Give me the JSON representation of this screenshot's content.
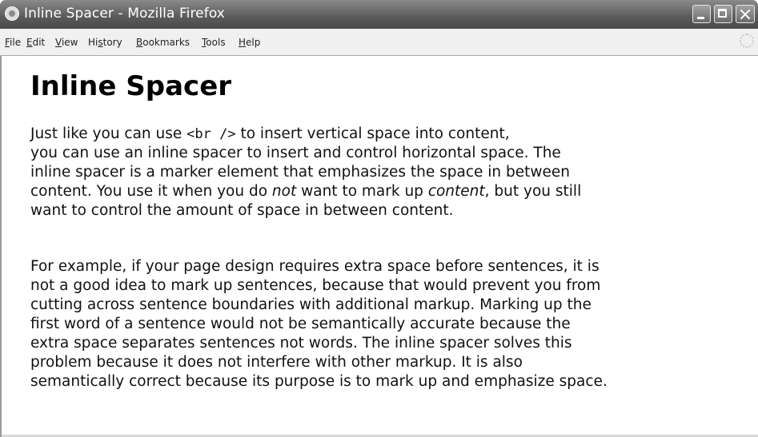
{
  "window": {
    "title": "Inline Spacer - Mozilla Firefox"
  },
  "menubar": {
    "items": [
      {
        "first": "F",
        "rest": "ile"
      },
      {
        "first": "E",
        "rest": "dit"
      },
      {
        "first": "V",
        "rest": "iew"
      },
      {
        "first": "",
        "pre": "Hi",
        "mid": "s",
        "rest": "tory"
      },
      {
        "first": "B",
        "rest": "ookmarks"
      },
      {
        "first": "T",
        "rest": "ools"
      },
      {
        "first": "H",
        "rest": "elp"
      }
    ]
  },
  "page": {
    "heading": "Inline Spacer",
    "para1": {
      "l1a": "Just like you can use ",
      "l1code": "<br />",
      "l1b": " to insert vertical space into content,",
      "l2": "you can use an inline spacer to insert and control horizontal space.   The",
      "l3": "inline spacer is a marker element that emphasizes the space in between",
      "l4a": "content.   You use it when you do ",
      "l4em1": "not",
      "l4b": " want to mark up ",
      "l4em2": "content",
      "l4c": ", but you still",
      "l5": "want to control the amount of space in between content."
    },
    "para2": {
      "l1": "For example, if your page design requires extra space before sentences, it is",
      "l2": "not a good idea to mark up sentences, because that would prevent you from",
      "l3": "cutting across sentence boundaries with additional markup.   Marking up the",
      "l4": "first word of a sentence would not be semantically accurate because the",
      "l5": "extra space separates sentences not words.   The inline spacer solves this",
      "l6": "problem because it does not interfere with other markup.   It is also",
      "l7": "semantically correct because its purpose is to mark up and emphasize space."
    }
  }
}
